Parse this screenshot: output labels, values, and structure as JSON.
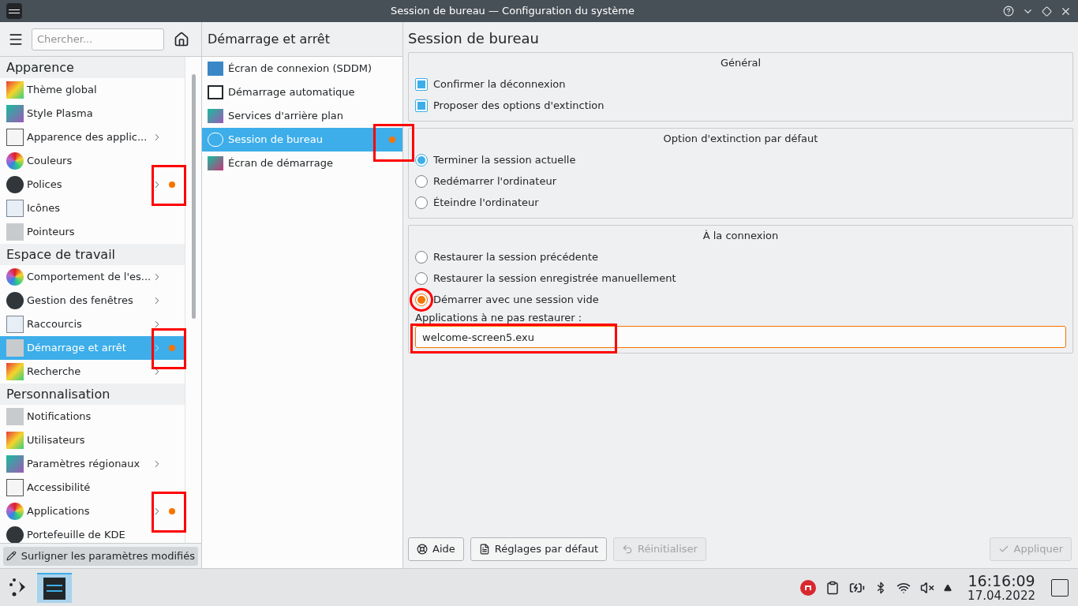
{
  "window": {
    "title": "Session de bureau — Configuration du système"
  },
  "sidebar": {
    "search_placeholder": "Chercher...",
    "sections": [
      {
        "title": "Apparence",
        "items": [
          {
            "label": "Thème global",
            "has_children": false,
            "changed": false,
            "selected": false,
            "annotated": false
          },
          {
            "label": "Style Plasma",
            "has_children": false,
            "changed": false,
            "selected": false,
            "annotated": false
          },
          {
            "label": "Apparence des applic...",
            "has_children": true,
            "changed": false,
            "selected": false,
            "annotated": false
          },
          {
            "label": "Couleurs",
            "has_children": false,
            "changed": false,
            "selected": false,
            "annotated": false
          },
          {
            "label": "Polices",
            "has_children": true,
            "changed": true,
            "selected": false,
            "annotated": true
          },
          {
            "label": "Icônes",
            "has_children": false,
            "changed": false,
            "selected": false,
            "annotated": false
          },
          {
            "label": "Pointeurs",
            "has_children": false,
            "changed": false,
            "selected": false,
            "annotated": false
          }
        ]
      },
      {
        "title": "Espace de travail",
        "items": [
          {
            "label": "Comportement de l'es...",
            "has_children": true,
            "changed": false,
            "selected": false,
            "annotated": false
          },
          {
            "label": "Gestion des fenêtres",
            "has_children": true,
            "changed": false,
            "selected": false,
            "annotated": false
          },
          {
            "label": "Raccourcis",
            "has_children": true,
            "changed": false,
            "selected": false,
            "annotated": false
          },
          {
            "label": "Démarrage et arrêt",
            "has_children": true,
            "changed": true,
            "selected": true,
            "annotated": true
          },
          {
            "label": "Recherche",
            "has_children": true,
            "changed": false,
            "selected": false,
            "annotated": false
          }
        ]
      },
      {
        "title": "Personnalisation",
        "items": [
          {
            "label": "Notifications",
            "has_children": false,
            "changed": false,
            "selected": false,
            "annotated": false
          },
          {
            "label": "Utilisateurs",
            "has_children": false,
            "changed": false,
            "selected": false,
            "annotated": false
          },
          {
            "label": "Paramètres régionaux",
            "has_children": true,
            "changed": false,
            "selected": false,
            "annotated": false
          },
          {
            "label": "Accessibilité",
            "has_children": false,
            "changed": false,
            "selected": false,
            "annotated": false
          },
          {
            "label": "Applications",
            "has_children": true,
            "changed": true,
            "selected": false,
            "annotated": true
          },
          {
            "label": "Portefeuille de KDE",
            "has_children": false,
            "changed": false,
            "selected": false,
            "annotated": false
          }
        ]
      }
    ],
    "highlight_button": {
      "label": "Surligner les paramètres modifiés",
      "on": true
    }
  },
  "middle": {
    "title": "Démarrage et arrêt",
    "items": [
      {
        "label": "Écran de connexion (SDDM)",
        "selected": false,
        "changed": false,
        "annotated": false
      },
      {
        "label": "Démarrage automatique",
        "selected": false,
        "changed": false,
        "annotated": false
      },
      {
        "label": "Services d'arrière plan",
        "selected": false,
        "changed": false,
        "annotated": false
      },
      {
        "label": "Session de bureau",
        "selected": true,
        "changed": true,
        "annotated": true
      },
      {
        "label": "Écran de démarrage",
        "selected": false,
        "changed": false,
        "annotated": false
      }
    ]
  },
  "page": {
    "title": "Session de bureau",
    "groups": [
      {
        "title": "Général",
        "options": [
          {
            "kind": "checkbox",
            "label": "Confirmer la déconnexion",
            "checked": true,
            "changed": false,
            "annotated": false
          },
          {
            "kind": "checkbox",
            "label": "Proposer des options d'extinction",
            "checked": true,
            "changed": false,
            "annotated": false
          }
        ]
      },
      {
        "title": "Option d'extinction par défaut",
        "options": [
          {
            "kind": "radio",
            "label": "Terminer la session actuelle",
            "checked": true,
            "changed": false,
            "annotated": false
          },
          {
            "kind": "radio",
            "label": "Redémarrer l'ordinateur",
            "checked": false,
            "changed": false,
            "annotated": false
          },
          {
            "kind": "radio",
            "label": "Éteindre l'ordinateur",
            "checked": false,
            "changed": false,
            "annotated": false
          }
        ]
      },
      {
        "title": "À la connexion",
        "options": [
          {
            "kind": "radio",
            "label": "Restaurer la session précédente",
            "checked": false,
            "changed": false,
            "annotated": false
          },
          {
            "kind": "radio",
            "label": "Restaurer la session enregistrée manuellement",
            "checked": false,
            "changed": false,
            "annotated": false
          },
          {
            "kind": "radio",
            "label": "Démarrer avec une session vide",
            "checked": true,
            "changed": true,
            "annotated": true
          }
        ],
        "field": {
          "label": "Applications à ne pas restaurer :",
          "value": "welcome-screen5.exu",
          "changed": true,
          "annotated": true
        }
      }
    ],
    "buttons": [
      {
        "kind": "help",
        "label": "Aide",
        "disabled": false
      },
      {
        "kind": "defaults",
        "label": "Réglages par défaut",
        "disabled": false
      },
      {
        "kind": "reset",
        "label": "Réinitialiser",
        "disabled": true
      }
    ],
    "apply_button": {
      "label": "Appliquer",
      "disabled": true
    }
  },
  "taskbar": {
    "time": "16:16:09",
    "date": "17.04.2022"
  }
}
